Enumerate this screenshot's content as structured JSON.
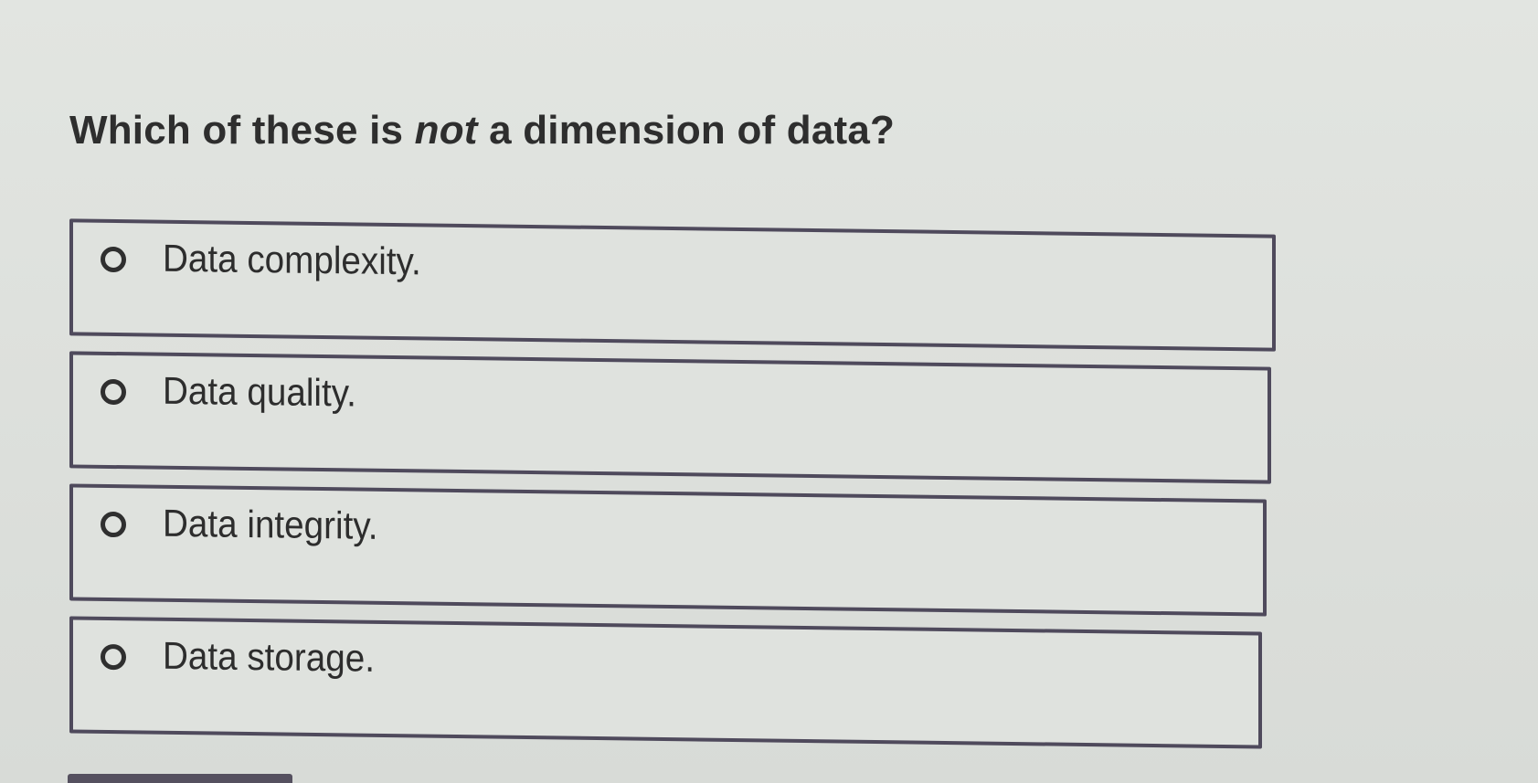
{
  "question": {
    "before": "Which of these is ",
    "emphasis": "not",
    "after": " a dimension of data?"
  },
  "options": [
    {
      "label": "Data complexity."
    },
    {
      "label": "Data quality."
    },
    {
      "label": "Data integrity."
    },
    {
      "label": "Data storage."
    }
  ],
  "colors": {
    "background": "#dde1dd",
    "option_border": "#4f4a5c",
    "text": "#2b2b2b",
    "button": "#55505f"
  }
}
